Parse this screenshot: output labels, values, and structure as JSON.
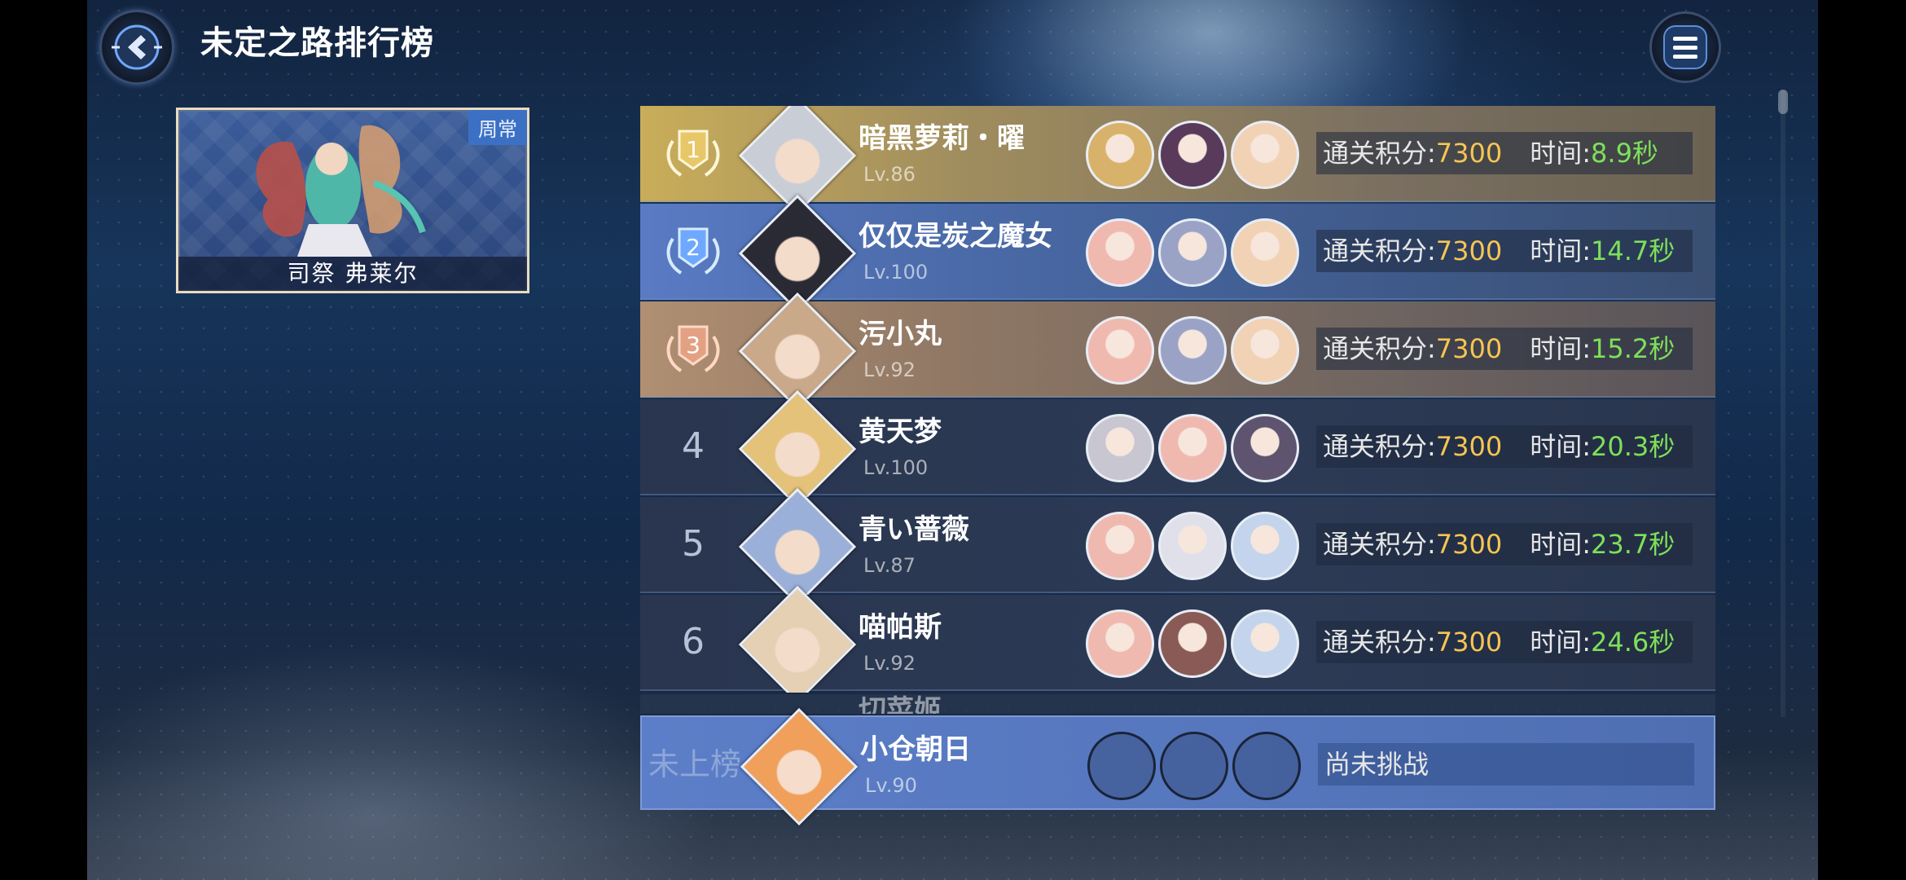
{
  "header": {
    "title": "未定之路排行榜",
    "back_icon": "back-arrow-icon",
    "menu_icon": "hamburger-menu-icon"
  },
  "boss": {
    "tag": "周常",
    "name": "司祭 弗莱尔"
  },
  "labels": {
    "score": "通关积分:",
    "time": "时间:"
  },
  "rows": [
    {
      "rank": "1",
      "style": "gold",
      "name": "暗黑萝莉・曜",
      "level": "Lv.86",
      "score": "7300",
      "time": "8.9秒",
      "avatar_color": "#c9cdd6",
      "team_colors": [
        "#d8b26a",
        "#5a3a5a",
        "#f1d2b5"
      ]
    },
    {
      "rank": "2",
      "style": "silver",
      "name": "仅仅是炭之魔女",
      "level": "Lv.100",
      "score": "7300",
      "time": "14.7秒",
      "avatar_color": "#2a2a34",
      "team_colors": [
        "#f0b9b0",
        "#9aa2c6",
        "#f1d2b5"
      ]
    },
    {
      "rank": "3",
      "style": "bronze",
      "name": "污小丸",
      "level": "Lv.92",
      "score": "7300",
      "time": "15.2秒",
      "avatar_color": "#c9a98a",
      "team_colors": [
        "#f0b9b0",
        "#9aa2c6",
        "#f1d2b5"
      ]
    },
    {
      "rank": "4",
      "style": "normal",
      "name": "黄天梦",
      "level": "Lv.100",
      "score": "7300",
      "time": "20.3秒",
      "avatar_color": "#e4c27a",
      "team_colors": [
        "#c8c6d0",
        "#f0b9b0",
        "#5e5470"
      ]
    },
    {
      "rank": "5",
      "style": "normal",
      "name": "青い蔷薇",
      "level": "Lv.87",
      "score": "7300",
      "time": "23.7秒",
      "avatar_color": "#9ab0d8",
      "team_colors": [
        "#f0b9b0",
        "#dfe0ea",
        "#c3d4ec"
      ]
    },
    {
      "rank": "6",
      "style": "normal",
      "name": "喵帕斯",
      "level": "Lv.92",
      "score": "7300",
      "time": "24.6秒",
      "avatar_color": "#e6d0b4",
      "team_colors": [
        "#f0b9b0",
        "#8a5b56",
        "#c3d4ec"
      ]
    }
  ],
  "partial_row": {
    "name": "切菜姬"
  },
  "mine": {
    "rank": "未上榜",
    "name": "小仓朝日",
    "level": "Lv.90",
    "status": "尚未挑战",
    "avatar_color": "#f0a05a"
  },
  "colors": {
    "gold": "#f6c552",
    "green": "#7ee05a"
  }
}
